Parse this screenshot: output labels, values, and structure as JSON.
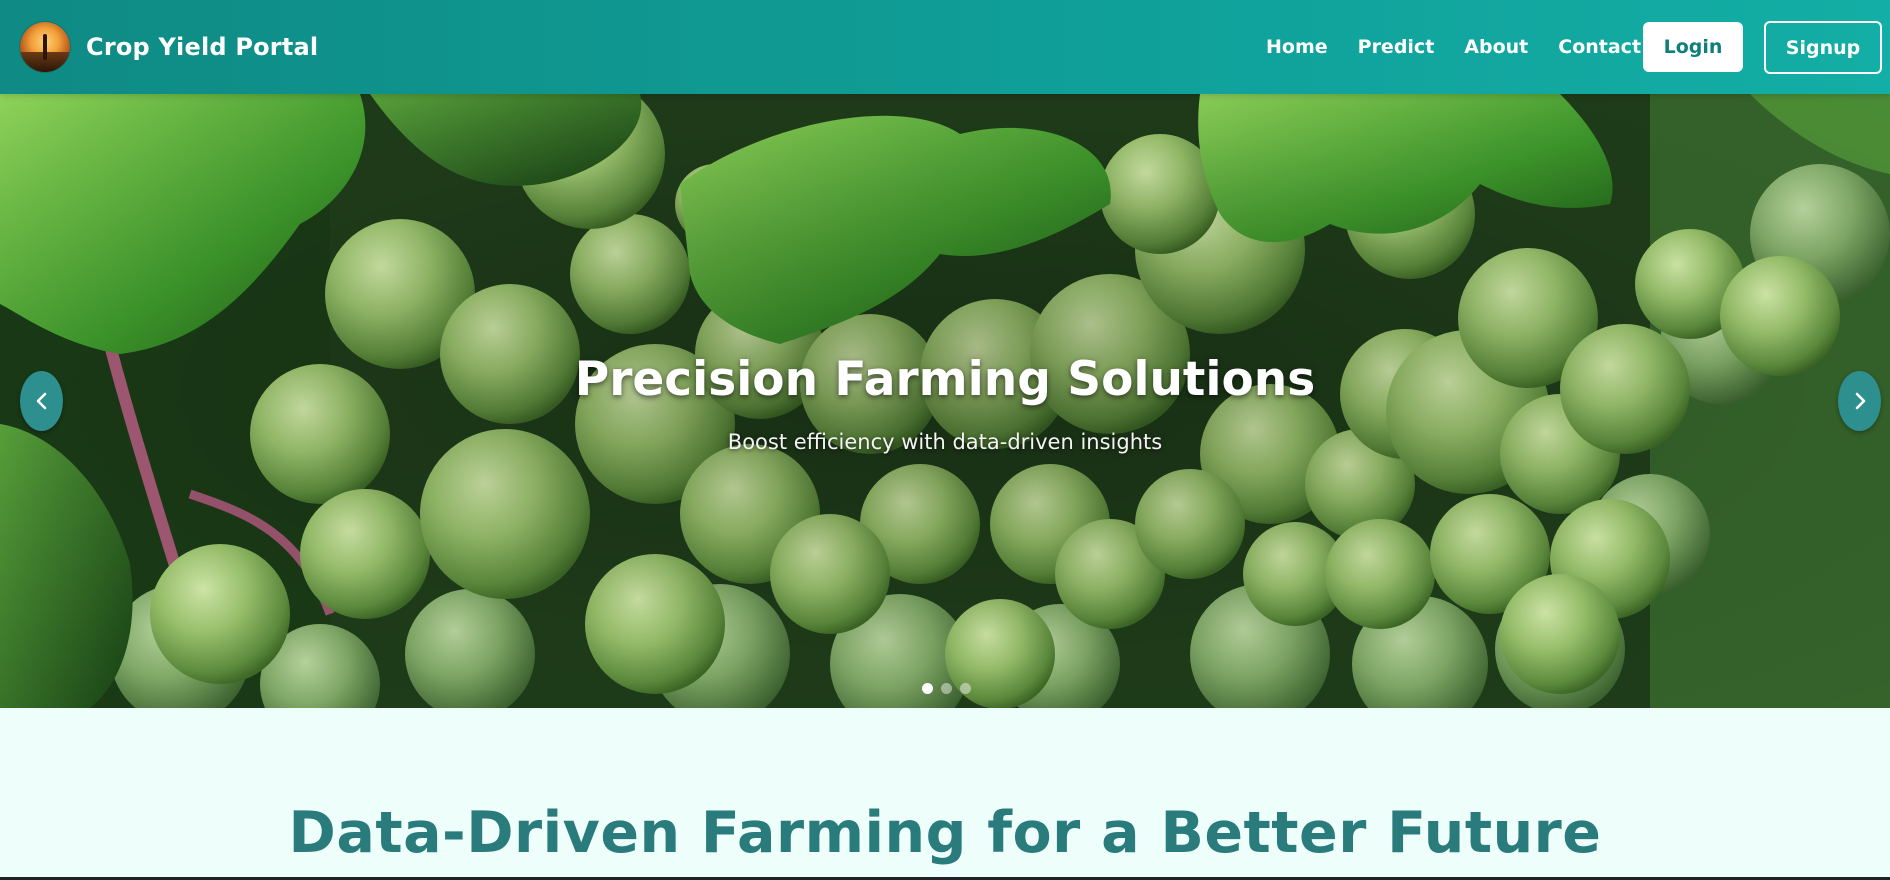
{
  "navbar": {
    "brand_name": "Crop Yield Portal",
    "links": [
      {
        "label": "Home"
      },
      {
        "label": "Predict"
      },
      {
        "label": "About"
      },
      {
        "label": "Contact"
      }
    ],
    "login_label": "Login",
    "signup_label": "Signup"
  },
  "hero": {
    "title": "Precision Farming Solutions",
    "subtitle": "Boost efficiency with data-driven insights",
    "prev_icon": "chevron-left-icon",
    "next_icon": "chevron-right-icon",
    "slide_count": 3,
    "active_slide": 1
  },
  "section": {
    "title": "Data-Driven Farming for a Better Future"
  },
  "colors": {
    "navbar_start": "#0f8a84",
    "navbar_end": "#13aea5",
    "accent_teal": "#2a7b7b",
    "carousel_button": "#2e8f8f",
    "page_background": "#eefffb"
  }
}
